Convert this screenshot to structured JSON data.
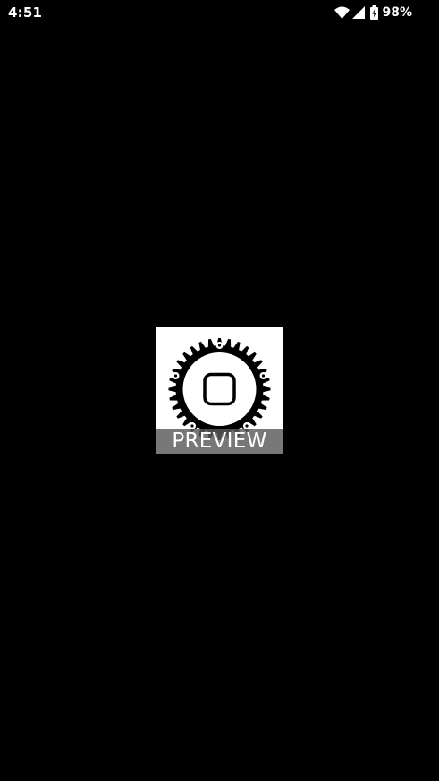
{
  "status_bar": {
    "time": "4:51",
    "battery_percent": "98%",
    "icons": [
      "wifi-icon",
      "cell-signal-icon",
      "battery-charging-icon"
    ]
  },
  "preview": {
    "label": "PREVIEW",
    "image_icon": "chainring-gear-icon"
  },
  "colors": {
    "background": "#000000",
    "foreground": "#ffffff"
  }
}
